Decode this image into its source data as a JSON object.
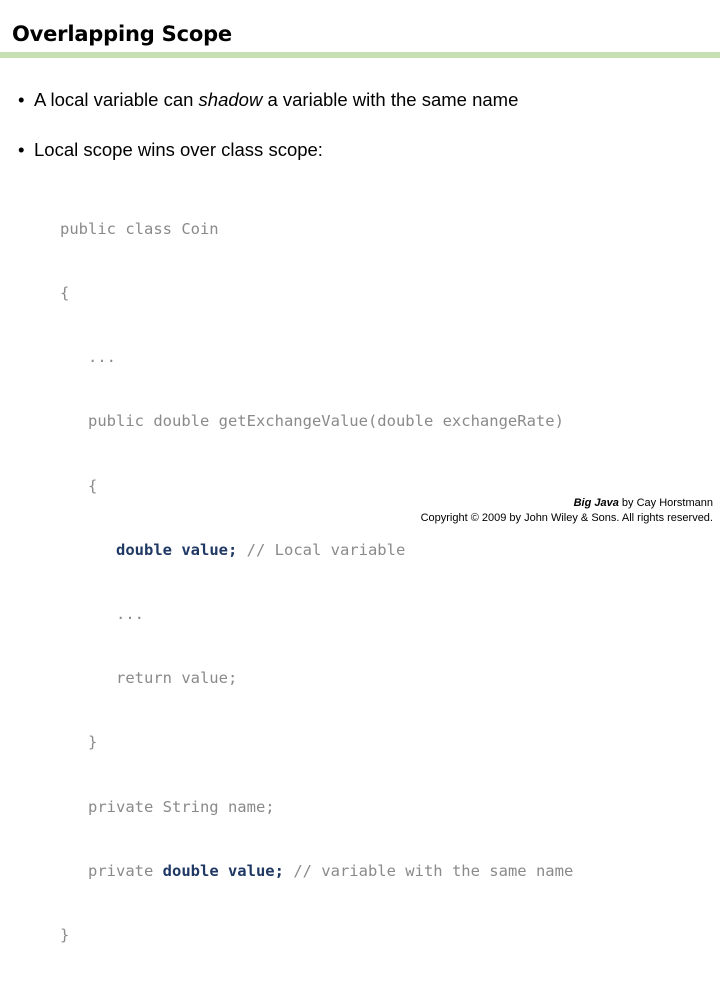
{
  "slide": {
    "title": "Overlapping Scope",
    "accent_color": "#C6E0B4",
    "highlight_color": "#1F3864",
    "code_color": "#8A8A8A",
    "bullet_marker": "•"
  },
  "bullets": [
    {
      "before": "A local variable can ",
      "emphasis": "shadow",
      "after": " a variable with the same name"
    },
    {
      "before": "Local scope wins over class scope:",
      "emphasis": "",
      "after": ""
    }
  ],
  "code": {
    "lines": [
      {
        "plain": "public class Coin"
      },
      {
        "plain": "{"
      },
      {
        "plain": "   ..."
      },
      {
        "plain": "   public double getExchangeValue(double exchangeRate)"
      },
      {
        "plain": "   {"
      },
      {
        "pre": "      ",
        "highlight": "double value;",
        "post": " // Local variable"
      },
      {
        "plain": "      ..."
      },
      {
        "plain": "      return value;"
      },
      {
        "plain": "   }"
      },
      {
        "plain": "   private String name;"
      },
      {
        "pre": "   private ",
        "highlight": "double value;",
        "post": " // variable with the same name"
      },
      {
        "plain": "}"
      }
    ]
  },
  "footer": {
    "book_title": "Big Java",
    "byline": " by Cay Horstmann",
    "copyright": "Copyright © 2009 by John Wiley & Sons.  All rights reserved."
  }
}
